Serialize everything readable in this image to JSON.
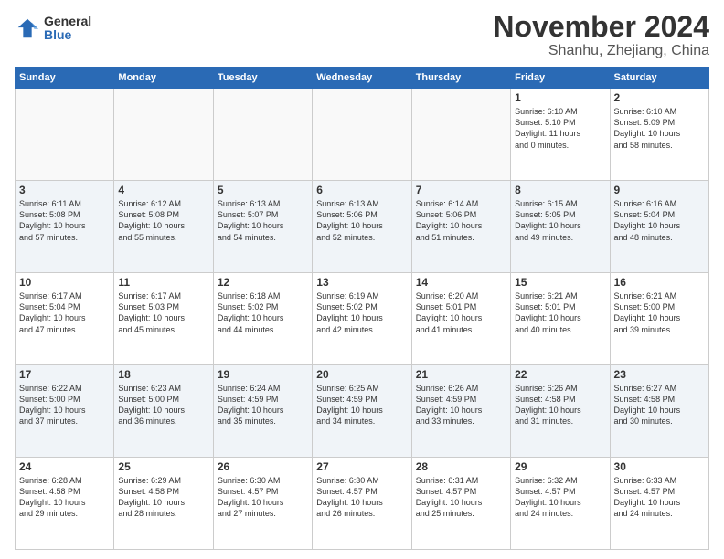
{
  "logo": {
    "general": "General",
    "blue": "Blue"
  },
  "header": {
    "month": "November 2024",
    "location": "Shanhu, Zhejiang, China"
  },
  "weekdays": [
    "Sunday",
    "Monday",
    "Tuesday",
    "Wednesday",
    "Thursday",
    "Friday",
    "Saturday"
  ],
  "weeks": [
    [
      {
        "day": "",
        "info": ""
      },
      {
        "day": "",
        "info": ""
      },
      {
        "day": "",
        "info": ""
      },
      {
        "day": "",
        "info": ""
      },
      {
        "day": "",
        "info": ""
      },
      {
        "day": "1",
        "info": "Sunrise: 6:10 AM\nSunset: 5:10 PM\nDaylight: 11 hours\nand 0 minutes."
      },
      {
        "day": "2",
        "info": "Sunrise: 6:10 AM\nSunset: 5:09 PM\nDaylight: 10 hours\nand 58 minutes."
      }
    ],
    [
      {
        "day": "3",
        "info": "Sunrise: 6:11 AM\nSunset: 5:08 PM\nDaylight: 10 hours\nand 57 minutes."
      },
      {
        "day": "4",
        "info": "Sunrise: 6:12 AM\nSunset: 5:08 PM\nDaylight: 10 hours\nand 55 minutes."
      },
      {
        "day": "5",
        "info": "Sunrise: 6:13 AM\nSunset: 5:07 PM\nDaylight: 10 hours\nand 54 minutes."
      },
      {
        "day": "6",
        "info": "Sunrise: 6:13 AM\nSunset: 5:06 PM\nDaylight: 10 hours\nand 52 minutes."
      },
      {
        "day": "7",
        "info": "Sunrise: 6:14 AM\nSunset: 5:06 PM\nDaylight: 10 hours\nand 51 minutes."
      },
      {
        "day": "8",
        "info": "Sunrise: 6:15 AM\nSunset: 5:05 PM\nDaylight: 10 hours\nand 49 minutes."
      },
      {
        "day": "9",
        "info": "Sunrise: 6:16 AM\nSunset: 5:04 PM\nDaylight: 10 hours\nand 48 minutes."
      }
    ],
    [
      {
        "day": "10",
        "info": "Sunrise: 6:17 AM\nSunset: 5:04 PM\nDaylight: 10 hours\nand 47 minutes."
      },
      {
        "day": "11",
        "info": "Sunrise: 6:17 AM\nSunset: 5:03 PM\nDaylight: 10 hours\nand 45 minutes."
      },
      {
        "day": "12",
        "info": "Sunrise: 6:18 AM\nSunset: 5:02 PM\nDaylight: 10 hours\nand 44 minutes."
      },
      {
        "day": "13",
        "info": "Sunrise: 6:19 AM\nSunset: 5:02 PM\nDaylight: 10 hours\nand 42 minutes."
      },
      {
        "day": "14",
        "info": "Sunrise: 6:20 AM\nSunset: 5:01 PM\nDaylight: 10 hours\nand 41 minutes."
      },
      {
        "day": "15",
        "info": "Sunrise: 6:21 AM\nSunset: 5:01 PM\nDaylight: 10 hours\nand 40 minutes."
      },
      {
        "day": "16",
        "info": "Sunrise: 6:21 AM\nSunset: 5:00 PM\nDaylight: 10 hours\nand 39 minutes."
      }
    ],
    [
      {
        "day": "17",
        "info": "Sunrise: 6:22 AM\nSunset: 5:00 PM\nDaylight: 10 hours\nand 37 minutes."
      },
      {
        "day": "18",
        "info": "Sunrise: 6:23 AM\nSunset: 5:00 PM\nDaylight: 10 hours\nand 36 minutes."
      },
      {
        "day": "19",
        "info": "Sunrise: 6:24 AM\nSunset: 4:59 PM\nDaylight: 10 hours\nand 35 minutes."
      },
      {
        "day": "20",
        "info": "Sunrise: 6:25 AM\nSunset: 4:59 PM\nDaylight: 10 hours\nand 34 minutes."
      },
      {
        "day": "21",
        "info": "Sunrise: 6:26 AM\nSunset: 4:59 PM\nDaylight: 10 hours\nand 33 minutes."
      },
      {
        "day": "22",
        "info": "Sunrise: 6:26 AM\nSunset: 4:58 PM\nDaylight: 10 hours\nand 31 minutes."
      },
      {
        "day": "23",
        "info": "Sunrise: 6:27 AM\nSunset: 4:58 PM\nDaylight: 10 hours\nand 30 minutes."
      }
    ],
    [
      {
        "day": "24",
        "info": "Sunrise: 6:28 AM\nSunset: 4:58 PM\nDaylight: 10 hours\nand 29 minutes."
      },
      {
        "day": "25",
        "info": "Sunrise: 6:29 AM\nSunset: 4:58 PM\nDaylight: 10 hours\nand 28 minutes."
      },
      {
        "day": "26",
        "info": "Sunrise: 6:30 AM\nSunset: 4:57 PM\nDaylight: 10 hours\nand 27 minutes."
      },
      {
        "day": "27",
        "info": "Sunrise: 6:30 AM\nSunset: 4:57 PM\nDaylight: 10 hours\nand 26 minutes."
      },
      {
        "day": "28",
        "info": "Sunrise: 6:31 AM\nSunset: 4:57 PM\nDaylight: 10 hours\nand 25 minutes."
      },
      {
        "day": "29",
        "info": "Sunrise: 6:32 AM\nSunset: 4:57 PM\nDaylight: 10 hours\nand 24 minutes."
      },
      {
        "day": "30",
        "info": "Sunrise: 6:33 AM\nSunset: 4:57 PM\nDaylight: 10 hours\nand 24 minutes."
      }
    ]
  ]
}
